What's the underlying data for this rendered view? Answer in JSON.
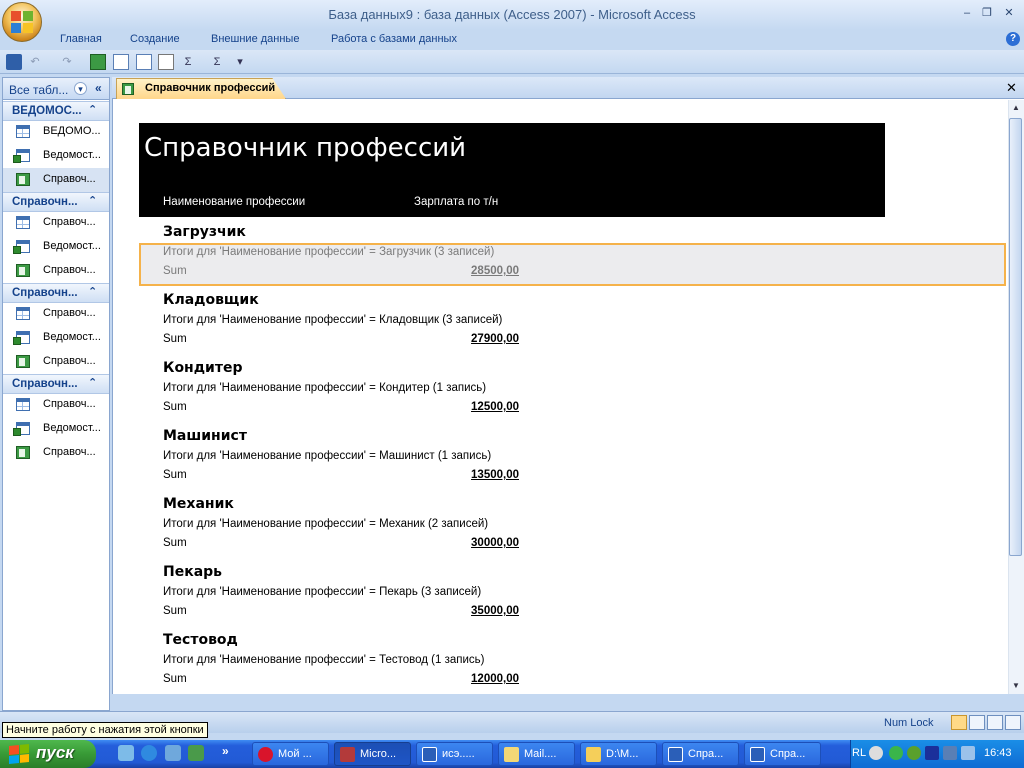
{
  "window": {
    "title": "База данных9 : база данных (Access 2007) - Microsoft Access",
    "minimize": "–",
    "restore": "❐",
    "close": "✕"
  },
  "ribbon": {
    "tabs": [
      "Главная",
      "Создание",
      "Внешние данные",
      "Работа с базами данных"
    ],
    "help": "?"
  },
  "qat": {
    "sigma1": "Σ",
    "sigma2": "Σ",
    "dropdown": "▾"
  },
  "nav_pane": {
    "header": "Все табл...",
    "dropdown": "▾",
    "collapse": "«",
    "groups": [
      {
        "label": "ВЕДОМОС...",
        "toggle": "⌃",
        "items": [
          {
            "label": "ВЕДОМО...",
            "icon": "table-icon"
          },
          {
            "label": "Ведомост...",
            "icon": "query-icon"
          },
          {
            "label": "Справоч...",
            "icon": "report-icon"
          }
        ]
      },
      {
        "label": "Справочн...",
        "toggle": "⌃",
        "items": [
          {
            "label": "Справоч...",
            "icon": "table-icon"
          },
          {
            "label": "Ведомост...",
            "icon": "query-icon"
          },
          {
            "label": "Справоч...",
            "icon": "report-icon"
          }
        ]
      },
      {
        "label": "Справочн...",
        "toggle": "⌃",
        "items": [
          {
            "label": "Справоч...",
            "icon": "table-icon"
          },
          {
            "label": "Ведомост...",
            "icon": "query-icon"
          },
          {
            "label": "Справоч...",
            "icon": "report-icon"
          }
        ]
      },
      {
        "label": "Справочн...",
        "toggle": "⌃",
        "items": [
          {
            "label": "Справоч...",
            "icon": "table-icon"
          },
          {
            "label": "Ведомост...",
            "icon": "query-icon"
          },
          {
            "label": "Справоч...",
            "icon": "report-icon"
          }
        ]
      }
    ]
  },
  "document": {
    "tab_label": "Справочник профессий",
    "close": "✕"
  },
  "report": {
    "title": "Справочник профессий",
    "col_name": "Наименование профессии",
    "col_salary": "Зарплата по т/н",
    "groups": [
      {
        "name": "Загрузчик",
        "summary": "Итоги для 'Наименование профессии' =  Загрузчик (3 записей)",
        "sum_label": "Sum",
        "sum": "28500,00"
      },
      {
        "name": "Кладовщик",
        "summary": "Итоги для 'Наименование профессии' =  Кладовщик (3 записей)",
        "sum_label": "Sum",
        "sum": "27900,00"
      },
      {
        "name": "Кондитер",
        "summary": "Итоги для 'Наименование профессии' =  Кондитер (1 запись)",
        "sum_label": "Sum",
        "sum": "12500,00"
      },
      {
        "name": "Машинист",
        "summary": "Итоги для 'Наименование профессии' =  Машинист (1 запись)",
        "sum_label": "Sum",
        "sum": "13500,00"
      },
      {
        "name": "Механик",
        "summary": "Итоги для 'Наименование профессии' =  Механик (2 записей)",
        "sum_label": "Sum",
        "sum": "30000,00"
      },
      {
        "name": "Пекарь",
        "summary": "Итоги для 'Наименование профессии' =  Пекарь (3 записей)",
        "sum_label": "Sum",
        "sum": "35000,00"
      },
      {
        "name": "Тестовод",
        "summary": "Итоги для 'Наименование профессии' =  Тестовод (1 запись)",
        "sum_label": "Sum",
        "sum": "12000,00"
      }
    ]
  },
  "statusbar": {
    "tooltip": "Начните работу с нажатия этой кнопки",
    "numlock": "Num Lock"
  },
  "taskbar": {
    "start": "пуск",
    "buttons": [
      "Мой ...",
      "Micro...",
      "исэ.....",
      "Mail....",
      "D:\\М...",
      "Спра...",
      "Спра..."
    ],
    "lang": "RL",
    "clock": "16:43"
  },
  "colors": {
    "ribbon_text": "#15428b",
    "selection_border": "#f5b24a",
    "report_header_bg": "#000000",
    "taskbar_blue": "#245edb",
    "start_green": "#389a36"
  }
}
